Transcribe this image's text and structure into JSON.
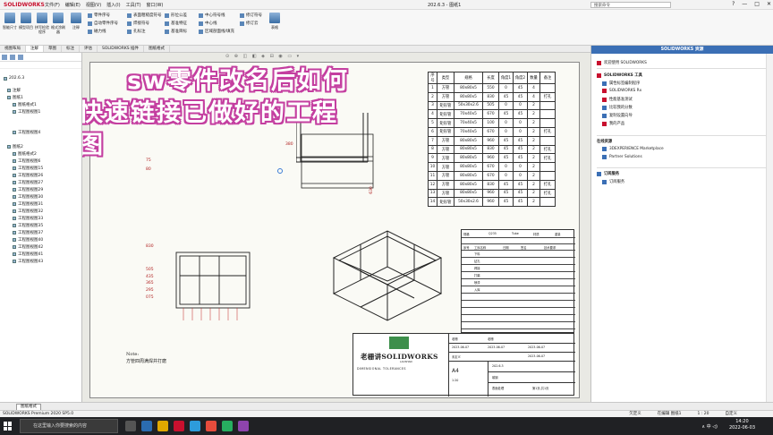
{
  "window": {
    "app_name": "SOLIDWORKS",
    "doc_title": "202.6.3 - 图纸1",
    "search_placeholder": "搜索命令",
    "menus": [
      "文件(F)",
      "编辑(E)",
      "视图(V)",
      "插入(I)",
      "工具(T)",
      "窗口(W)"
    ],
    "controls": [
      "?",
      "—",
      "□",
      "✕"
    ]
  },
  "ribbon": {
    "big_buttons": [
      "智能尺寸",
      "模型项目",
      "拼写检验程序",
      "格式涂刷器",
      "注释"
    ],
    "col1": [
      "零件序号",
      "自动零件序号",
      "磁力线"
    ],
    "col2": [
      "表面粗糙度符号",
      "焊接符号",
      "孔标注"
    ],
    "col3": [
      "形位公差",
      "基准特征",
      "基准目标"
    ],
    "col4": [
      "中心符号线",
      "中心线",
      "区域剖面线/填充"
    ],
    "col5": [
      "修订符号",
      "修订云"
    ],
    "tables_label": "表格"
  },
  "cmdtabs": [
    "视图布局",
    "注解",
    "草图",
    "标注",
    "评估",
    "SOLIDWORKS 插件",
    "图纸格式"
  ],
  "tree": {
    "items": [
      "202.6.3",
      "注解",
      "图纸1",
      "图纸格式1",
      "工程图视图1",
      "工程图视图4",
      "图纸2",
      "图纸格式2",
      "工程图视图6",
      "工程图视图15",
      "工程图视图26",
      "工程图视图27",
      "工程图视图29",
      "工程图视图30",
      "工程图视图31",
      "工程图视图32",
      "工程图视图33",
      "工程图视图35",
      "工程图视图37",
      "工程图视图40",
      "工程图视图42",
      "工程图视图41",
      "工程图视图43"
    ]
  },
  "overlay": {
    "line1": "sw零件改名后如何",
    "line2": "快速链接已做好的工程图"
  },
  "heads_up": "⊙ ⊕ ◫ ◧ ◈ ⊟ ◉ ▭ ▾",
  "bom": {
    "header": [
      "序号",
      "类型",
      "规格",
      "长度",
      "角度1",
      "角度2",
      "数量",
      "备注"
    ],
    "rows": [
      [
        "1",
        "方管",
        "80x80x5",
        "550",
        "0",
        "45",
        "4",
        ""
      ],
      [
        "2",
        "方管",
        "80x80x5",
        "830",
        "45",
        "45",
        "4",
        "打孔"
      ],
      [
        "3",
        "矩形管",
        "50x30x2.6",
        "505",
        "0",
        "0",
        "2",
        ""
      ],
      [
        "4",
        "矩形管",
        "70x40x5",
        "670",
        "45",
        "45",
        "2",
        ""
      ],
      [
        "5",
        "矩形管",
        "70x40x5",
        "100",
        "0",
        "0",
        "2",
        ""
      ],
      [
        "6",
        "矩形管",
        "70x40x5",
        "670",
        "0",
        "0",
        "2",
        "打孔"
      ],
      [
        "7",
        "方管",
        "80x80x5",
        "960",
        "45",
        "45",
        "2",
        ""
      ],
      [
        "8",
        "方管",
        "80x80x5",
        "830",
        "45",
        "45",
        "2",
        "打孔"
      ],
      [
        "9",
        "方管",
        "80x80x5",
        "960",
        "45",
        "45",
        "2",
        "打孔"
      ],
      [
        "10",
        "方管",
        "80x80x5",
        "670",
        "0",
        "0",
        "2",
        ""
      ],
      [
        "11",
        "方管",
        "80x80x5",
        "670",
        "0",
        "0",
        "2",
        ""
      ],
      [
        "12",
        "方管",
        "80x80x5",
        "830",
        "45",
        "45",
        "2",
        "打孔"
      ],
      [
        "13",
        "方管",
        "80x80x5",
        "960",
        "45",
        "45",
        "2",
        "打孔"
      ],
      [
        "14",
        "矩形管",
        "50x30x2.6",
        "960",
        "45",
        "45",
        "2",
        ""
      ]
    ]
  },
  "dims": {
    "front_left": [
      "75",
      "80"
    ],
    "front_top": "380",
    "front_right": "630",
    "side_top": "830",
    "side_left": [
      "505",
      "435",
      "365",
      "295",
      "075"
    ]
  },
  "note": {
    "heading": "Note:",
    "text": "方管四周满焊并打磨"
  },
  "titleblock": {
    "logo_text": "老栅讲SOLIDWORKS",
    "logo_sub": "LAOSHAN",
    "tolerance_label": "DIMENSIONAL TOLERANCES",
    "date1": "2023-06-07",
    "date2": "2023-06-07",
    "date3": "2023-06-07",
    "date4": "2023-06-07",
    "drawing_no": "202.6.3",
    "size": "A4",
    "scale": "1:20",
    "material": "碳钢",
    "finish": "表面处理",
    "designer": "老栅",
    "checker": "老栅",
    "reviewer": "未定义",
    "sheet": "第1页,共1页"
  },
  "revision": {
    "head": [
      "规格",
      "Q235",
      "Tube",
      "材质",
      "重量"
    ],
    "cols": [
      "序号",
      "工序名称",
      "日期",
      "签名",
      "技术要求"
    ],
    "steps": [
      "下料",
      "钻孔",
      "焊接",
      "打磨",
      "喷漆",
      "入库"
    ]
  },
  "taskpane": {
    "title": "SOLIDWORKS 资源",
    "items": [
      "欢迎使用 SOLIDWORKS",
      "SOLIDWORKS 工具",
      "属性标签编制程序",
      "SOLIDWORKS Rx",
      "性能基准测试",
      "比较我的分数",
      "复制设置向导",
      "我的产品",
      "在线资源",
      "3DEXPERIENCE Marketplace",
      "Partner Solutions",
      "订阅服务",
      "订阅服务"
    ]
  },
  "sheettab": "图纸格式",
  "status": {
    "left": "SOLIDWORKS Premium 2020 SP5.0",
    "right": [
      "欠定义",
      "在编辑 图纸1",
      "1 : 20",
      "自定义"
    ]
  },
  "taskbar": {
    "search": "在这里输入你要搜索的内容",
    "time": "14:20",
    "date": "2022-06-03",
    "tray": "∧ 中 ◁)"
  },
  "colors": {
    "overlay_outline": "#c43fa0",
    "sw_red": "#c8102e",
    "taskpane_head": "#3b6fb5",
    "taskbar": "#202124"
  }
}
